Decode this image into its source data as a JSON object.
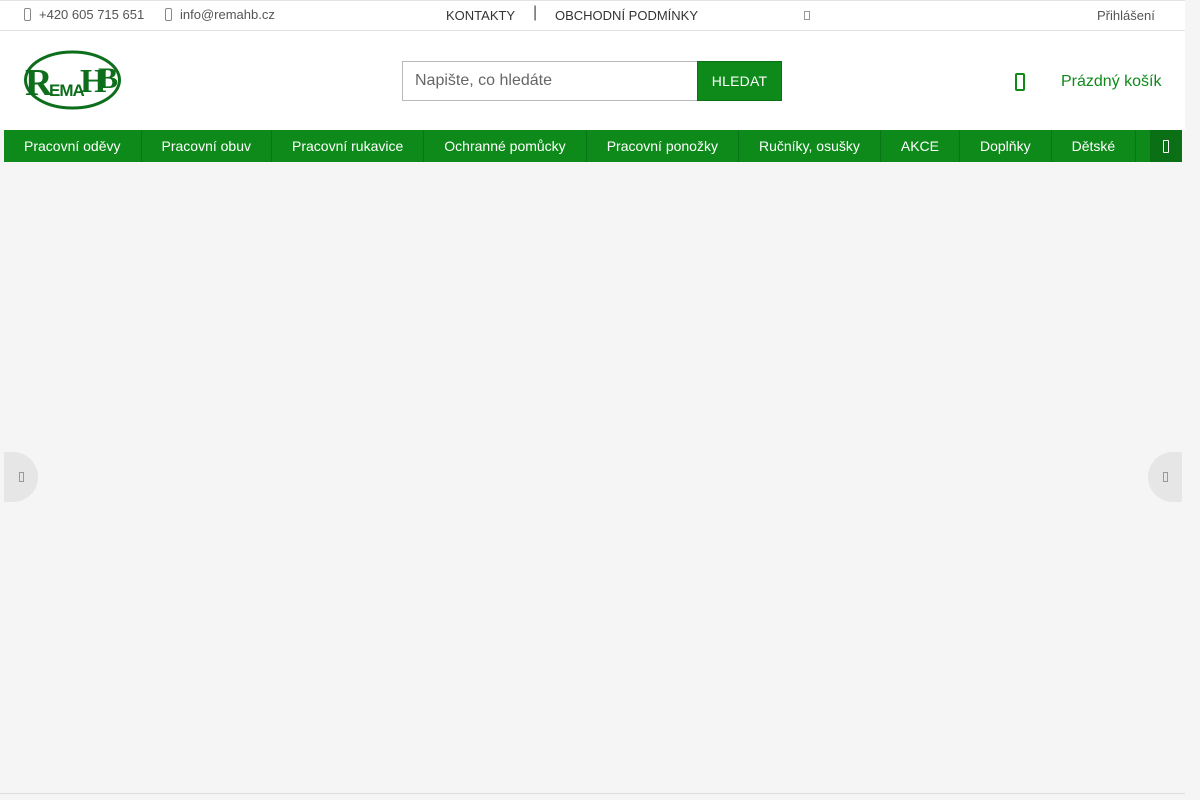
{
  "topbar": {
    "phone": "+420 605 715 651",
    "email": "info@remahb.cz",
    "links": [
      "KONTAKTY",
      "OBCHODNÍ PODMÍNKY"
    ],
    "separator": "|",
    "login": "Přihlášení"
  },
  "header": {
    "logo_text": "REMAHB",
    "search": {
      "placeholder": "Napište, co hledáte",
      "value": "",
      "button_label": "HLEDAT"
    },
    "cart_label": "Prázdný košík"
  },
  "nav": {
    "items": [
      "Pracovní oděvy",
      "Pracovní obuv",
      "Pracovní rukavice",
      "Ochranné pomůcky",
      "Pracovní ponožky",
      "Ručníky, osušky",
      "AKCE",
      "Doplňky",
      "Dětské"
    ]
  },
  "colors": {
    "brand_green": "#0d8a1a",
    "page_background": "#f5f5f5"
  },
  "icons": {
    "phone": "phone-icon",
    "email": "email-icon",
    "cart": "cart-icon",
    "nav_more": "menu-more-icon",
    "slider_prev": "chevron-left-icon",
    "slider_next": "chevron-right-icon"
  }
}
